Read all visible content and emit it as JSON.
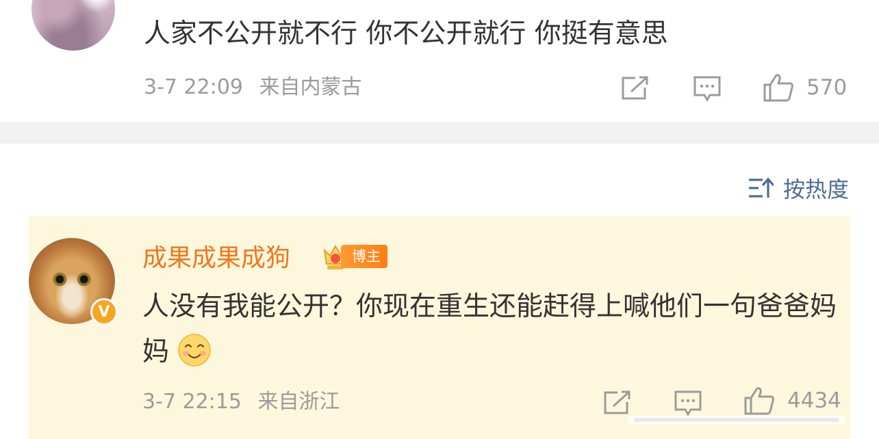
{
  "comment1": {
    "text": "人家不公开就不行  你不公开就行  你挺有意思",
    "time": "3-7 22:09",
    "location": "来自内蒙古",
    "likes": "570"
  },
  "sort": {
    "label": "按热度"
  },
  "comment2": {
    "username": "成果成果成狗",
    "badge": "博主",
    "text": "人没有我能公开？你现在重生还能赶得上喊他们一句爸爸妈妈",
    "time": "3-7 22:15",
    "location": "来自浙江",
    "likes": "4434"
  },
  "colors": {
    "username": "#f2761a",
    "meta": "#9b9b9b",
    "sort": "#4d6d96",
    "highlight_bg": "#fdf7dd",
    "separator": "#f2f2f2"
  },
  "icons": [
    "share-icon",
    "reply-icon",
    "like-icon",
    "sort-icon",
    "verified-icon",
    "crown-icon",
    "smile-emoji-icon"
  ]
}
